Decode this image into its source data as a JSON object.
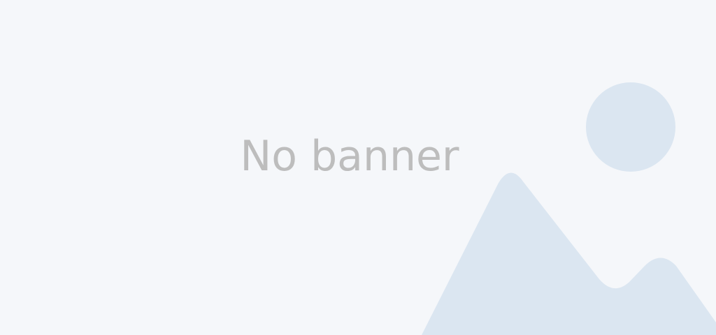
{
  "banner": {
    "message": "No banner",
    "background_color": "#f5f7fa",
    "text_color": "#bdbdbd",
    "illustration_icon": "image-placeholder-icon",
    "illustration_color": "#dbe6f1"
  }
}
